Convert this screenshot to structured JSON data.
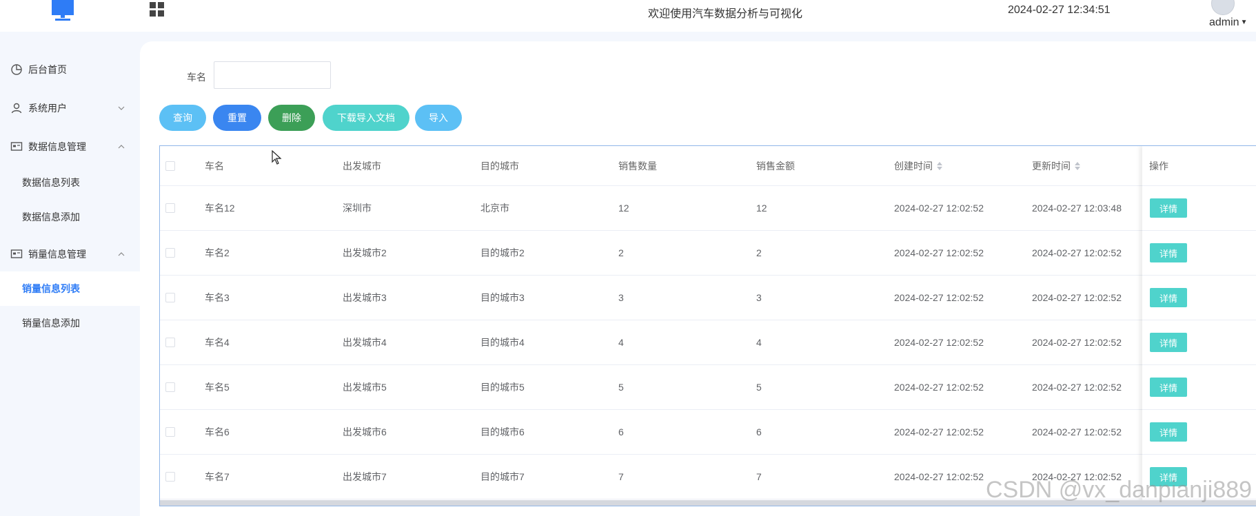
{
  "header": {
    "title": "欢迎使用汽车数据分析与可视化",
    "datetime": "2024-02-27 12:34:51",
    "user": "admin",
    "accent": "#2e7cf6"
  },
  "sidebar": {
    "items": [
      {
        "label": "后台首页"
      },
      {
        "label": "系统用户"
      },
      {
        "label": "数据信息管理"
      },
      {
        "label": "数据信息列表"
      },
      {
        "label": "数据信息添加"
      },
      {
        "label": "销量信息管理"
      },
      {
        "label": "销量信息列表"
      },
      {
        "label": "销量信息添加"
      }
    ]
  },
  "search": {
    "label": "车名",
    "value": "",
    "placeholder": ""
  },
  "toolbar": {
    "query": "查询",
    "reset": "重置",
    "delete": "删除",
    "download": "下载导入文档",
    "import": "导入"
  },
  "table": {
    "columns": [
      "车名",
      "出发城市",
      "目的城市",
      "销售数量",
      "销售金额",
      "创建时间",
      "更新时间",
      "操作"
    ],
    "detail_label": "详情",
    "rows": [
      [
        "车名12",
        "深圳市",
        "北京市",
        "12",
        "12",
        "2024-02-27 12:02:52",
        "2024-02-27 12:03:48"
      ],
      [
        "车名2",
        "出发城市2",
        "目的城市2",
        "2",
        "2",
        "2024-02-27 12:02:52",
        "2024-02-27 12:02:52"
      ],
      [
        "车名3",
        "出发城市3",
        "目的城市3",
        "3",
        "3",
        "2024-02-27 12:02:52",
        "2024-02-27 12:02:52"
      ],
      [
        "车名4",
        "出发城市4",
        "目的城市4",
        "4",
        "4",
        "2024-02-27 12:02:52",
        "2024-02-27 12:02:52"
      ],
      [
        "车名5",
        "出发城市5",
        "目的城市5",
        "5",
        "5",
        "2024-02-27 12:02:52",
        "2024-02-27 12:02:52"
      ],
      [
        "车名6",
        "出发城市6",
        "目的城市6",
        "6",
        "6",
        "2024-02-27 12:02:52",
        "2024-02-27 12:02:52"
      ],
      [
        "车名7",
        "出发城市7",
        "目的城市7",
        "7",
        "7",
        "2024-02-27 12:02:52",
        "2024-02-27 12:02:52"
      ]
    ]
  },
  "watermark": "CSDN @vx_danpianji889"
}
